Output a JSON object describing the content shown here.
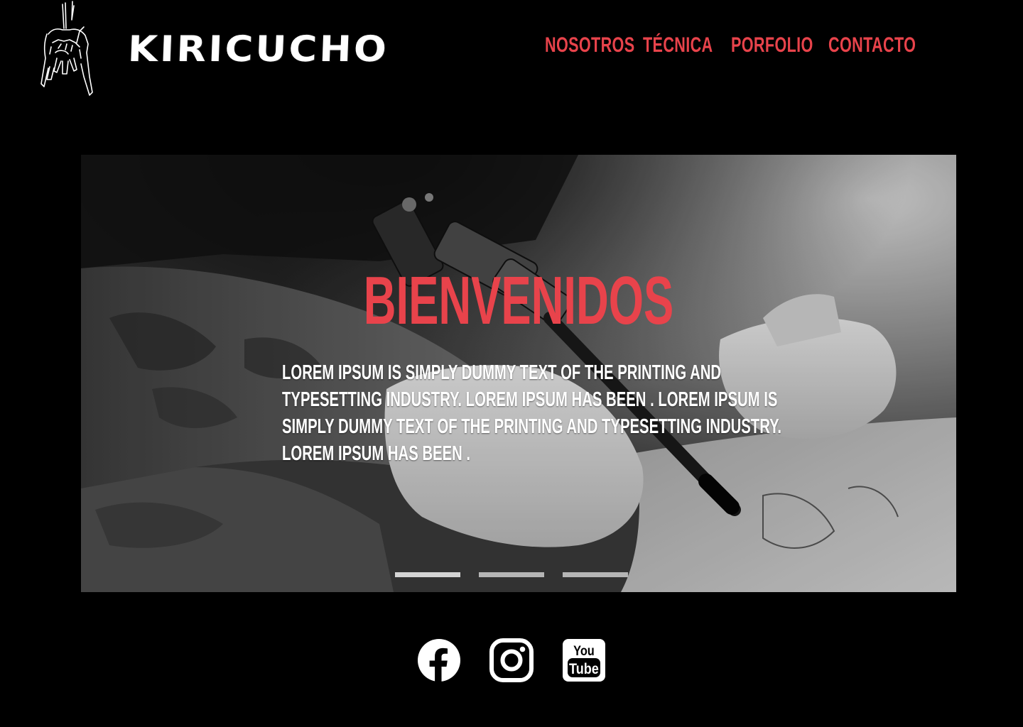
{
  "brand": {
    "name": "KIRICUCHO",
    "logo_icon": "rock-hand-icon"
  },
  "nav": {
    "items": [
      {
        "label": "NOSOTROS"
      },
      {
        "label": "TÉCNICA"
      },
      {
        "label": "PORFOLIO"
      },
      {
        "label": "CONTACTO"
      }
    ]
  },
  "hero": {
    "title": "BIENVENIDOS",
    "text": "Lorem Ipsum is simply dummy text of the printing and typesetting industry. Lorem Ipsum has been . Lorem Ipsum is simply dummy text of the printing and typesetting industry. Lorem Ipsum has been .",
    "slides_total": 3,
    "active_slide": 1
  },
  "social": {
    "items": [
      {
        "icon": "facebook-icon"
      },
      {
        "icon": "instagram-icon"
      },
      {
        "icon": "youtube-icon",
        "label_top": "You",
        "label_bottom": "Tube"
      }
    ]
  },
  "colors": {
    "background": "#000000",
    "accent": "#e8434b",
    "text": "#ffffff"
  }
}
